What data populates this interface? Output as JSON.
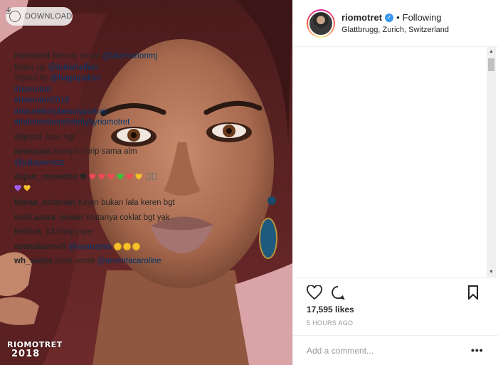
{
  "photo": {
    "download_label": "DOWNLOAD",
    "watermark_line1": "RIOMOTRET",
    "watermark_line2": "2018"
  },
  "header": {
    "username": "riomotret",
    "separator": "•",
    "follow_status": "Following",
    "location": "Glattbrugg, Zurich, Switzerland"
  },
  "caption": {
    "user": "riomotret",
    "text": "Beauty shoot",
    "mention1": "@lalamarionmj",
    "makeup_label": "Make up",
    "mention2": "@bubahalfian",
    "styled_label": "Styled by",
    "mention3": "@hagaipakan",
    "tags": [
      "#riomotret",
      "#riomotret2018",
      "#riocelebritybeautyportrait",
      "#indonesiancelebritybyriomotret"
    ]
  },
  "comments": [
    {
      "user": "siijessi",
      "text": "Jupe bgt"
    },
    {
      "user": "ayanajwa",
      "text": "Hampir mirip sama alm",
      "mention": "@juliaperrezz"
    },
    {
      "user": "dapur_manados",
      "text": ""
    },
    {
      "user": "klaraa_octavian",
      "text": "Kirain bukan lala keren bgt"
    },
    {
      "user": "indri.azura_ocean",
      "text": "matanya coklat bgt yak"
    },
    {
      "user": "fedrick_13",
      "text": "Mirip jupe"
    },
    {
      "user": "ayanakarmell",
      "mention": "@ayanajwa"
    },
    {
      "user": "wh_widya",
      "text": "idola venta",
      "mention": "@arventacaroline"
    }
  ],
  "hearts_row1": [
    "#262626",
    "#ed4956",
    "#ed4956",
    "#ed4956",
    "#3cc13b",
    "#ed4956",
    "#f7c12b"
  ],
  "hearts_row2": [
    "#a05ff0",
    "#f7c12b"
  ],
  "likes": "17,595 likes",
  "timestamp": "5 HOURS AGO",
  "comment_placeholder": "Add a comment...",
  "more_label": "•••",
  "icons": {
    "verified": "verified-badge-icon",
    "like": "heart-outline-icon",
    "comment": "speech-bubble-icon",
    "save": "bookmark-icon",
    "download": "download-arrow-icon"
  },
  "colors": {
    "link": "#003569",
    "verified": "#3897f0",
    "muted": "#999999",
    "text": "#262626"
  }
}
